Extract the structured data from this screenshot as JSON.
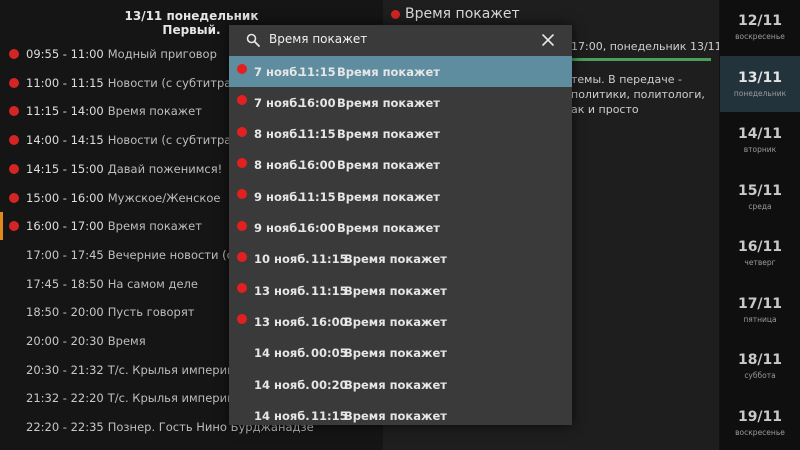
{
  "left_panel": {
    "header_date": "13/11  понедельник",
    "header_channel": "Первый.",
    "programs": [
      {
        "time": "09:55 - 11:00",
        "title": "Модный приговор",
        "dot": true
      },
      {
        "time": "11:00 - 11:15",
        "title": "Новости (с субтитрами)",
        "dot": true
      },
      {
        "time": "11:15 - 14:00",
        "title": "Время покажет",
        "dot": true
      },
      {
        "time": "14:00 - 14:15",
        "title": "Новости (с субтитрами)",
        "dot": true
      },
      {
        "time": "14:15 - 15:00",
        "title": "Давай поженимся!",
        "dot": true
      },
      {
        "time": "15:00 - 16:00",
        "title": "Мужское/Женское",
        "dot": true
      },
      {
        "time": "16:00 - 17:00",
        "title": "Время покажет",
        "dot": true
      },
      {
        "time": "17:00 - 17:45",
        "title": "Вечерние новости (с субт",
        "dot": false
      },
      {
        "time": "17:45 - 18:50",
        "title": "На самом деле",
        "dot": false
      },
      {
        "time": "18:50 - 20:00",
        "title": "Пусть говорят",
        "dot": false
      },
      {
        "time": "20:00 - 20:30",
        "title": "Время",
        "dot": false
      },
      {
        "time": "20:30 - 21:32",
        "title": "Т/с. Крылья империи. Кр",
        "dot": false
      },
      {
        "time": "21:32 - 22:20",
        "title": "Т/с. Крылья империи. Гр",
        "dot": false
      },
      {
        "time": "22:20 - 22:35",
        "title": "Познер. Гость Нино Бурджанадзе",
        "dot": false
      }
    ]
  },
  "middle_panel": {
    "title": "Время покажет",
    "time_info": "17:00, понедельник 13/11",
    "description": "темы. В передаче - политики, политологи, ак и просто"
  },
  "dates": [
    {
      "num": "12/11",
      "day": "воскресенье"
    },
    {
      "num": "13/11",
      "day": "понедельник"
    },
    {
      "num": "14/11",
      "day": "вторник"
    },
    {
      "num": "15/11",
      "day": "среда"
    },
    {
      "num": "16/11",
      "day": "четверг"
    },
    {
      "num": "17/11",
      "day": "пятница"
    },
    {
      "num": "18/11",
      "day": "суббота"
    },
    {
      "num": "19/11",
      "day": "воскресенье"
    }
  ],
  "search": {
    "query": "Время покажет",
    "results": [
      {
        "date": "7 нояб.",
        "time": "11:15",
        "title": "Время покажет",
        "dot": true
      },
      {
        "date": "7 нояб.",
        "time": "16:00",
        "title": "Время покажет",
        "dot": true
      },
      {
        "date": "8 нояб.",
        "time": "11:15",
        "title": "Время покажет",
        "dot": true
      },
      {
        "date": "8 нояб.",
        "time": "16:00",
        "title": "Время покажет",
        "dot": true
      },
      {
        "date": "9 нояб.",
        "time": "11:15",
        "title": "Время покажет",
        "dot": true
      },
      {
        "date": "9 нояб.",
        "time": "16:00",
        "title": "Время покажет",
        "dot": true
      },
      {
        "date": "10 нояб.",
        "time": "11:15",
        "title": "Время покажет",
        "dot": true
      },
      {
        "date": "13 нояб.",
        "time": "11:15",
        "title": "Время покажет",
        "dot": true
      },
      {
        "date": "13 нояб.",
        "time": "16:00",
        "title": "Время покажет",
        "dot": true
      },
      {
        "date": "14 нояб.",
        "time": "00:05",
        "title": "Время покажет",
        "dot": false
      },
      {
        "date": "14 нояб.",
        "time": "00:20",
        "title": "Время покажет",
        "dot": false
      },
      {
        "date": "14 нояб.",
        "time": "11:15",
        "title": "Время покажет",
        "dot": false
      }
    ]
  },
  "colors": {
    "record_dot": "#d42424",
    "active_row": "#5f8da0",
    "current_marker": "#e08a1e",
    "progress_bar": "#4a9e5a"
  }
}
